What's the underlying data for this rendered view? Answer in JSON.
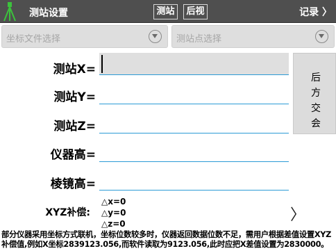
{
  "titlebar": {
    "app_icon": "survey-tripod-icon",
    "title": "测站设置",
    "station_button": "测站",
    "backsight_button": "后视",
    "record_label": "记录 〉"
  },
  "dropdowns": {
    "coord_file_placeholder": "坐标文件选择",
    "station_point_placeholder": "测站点选择",
    "arrow_icon": "circle-chevron-down-icon"
  },
  "form": {
    "station_x_label": "测站X=",
    "station_x_value": "",
    "station_y_label": "测站Y=",
    "station_y_value": "",
    "station_z_label": "测站Z=",
    "station_z_value": "",
    "instrument_height_label": "仪器高=",
    "instrument_height_value": "",
    "prism_height_label": "棱镜高=",
    "prism_height_value": ""
  },
  "side_button": {
    "label": "后方交会"
  },
  "xyz_compensation": {
    "label": "XYZ补偿:",
    "dx": "△x=0",
    "dy": "△y=0",
    "dz": "△z=0",
    "chevron": "〉"
  },
  "note": "部分仪器采用坐标方式联机，坐标位数较多时，仪器返回数据位数不足，需用户根据差值设置XYZ补偿值,例如X坐标2839123.056,而软件读取为9123.056,此时应把X差值设置为2830000。",
  "colors": {
    "titlebar_bg": "#4f4f4f",
    "field_underline": "#2b9bd6",
    "dropdown_bg": "#dedede"
  }
}
